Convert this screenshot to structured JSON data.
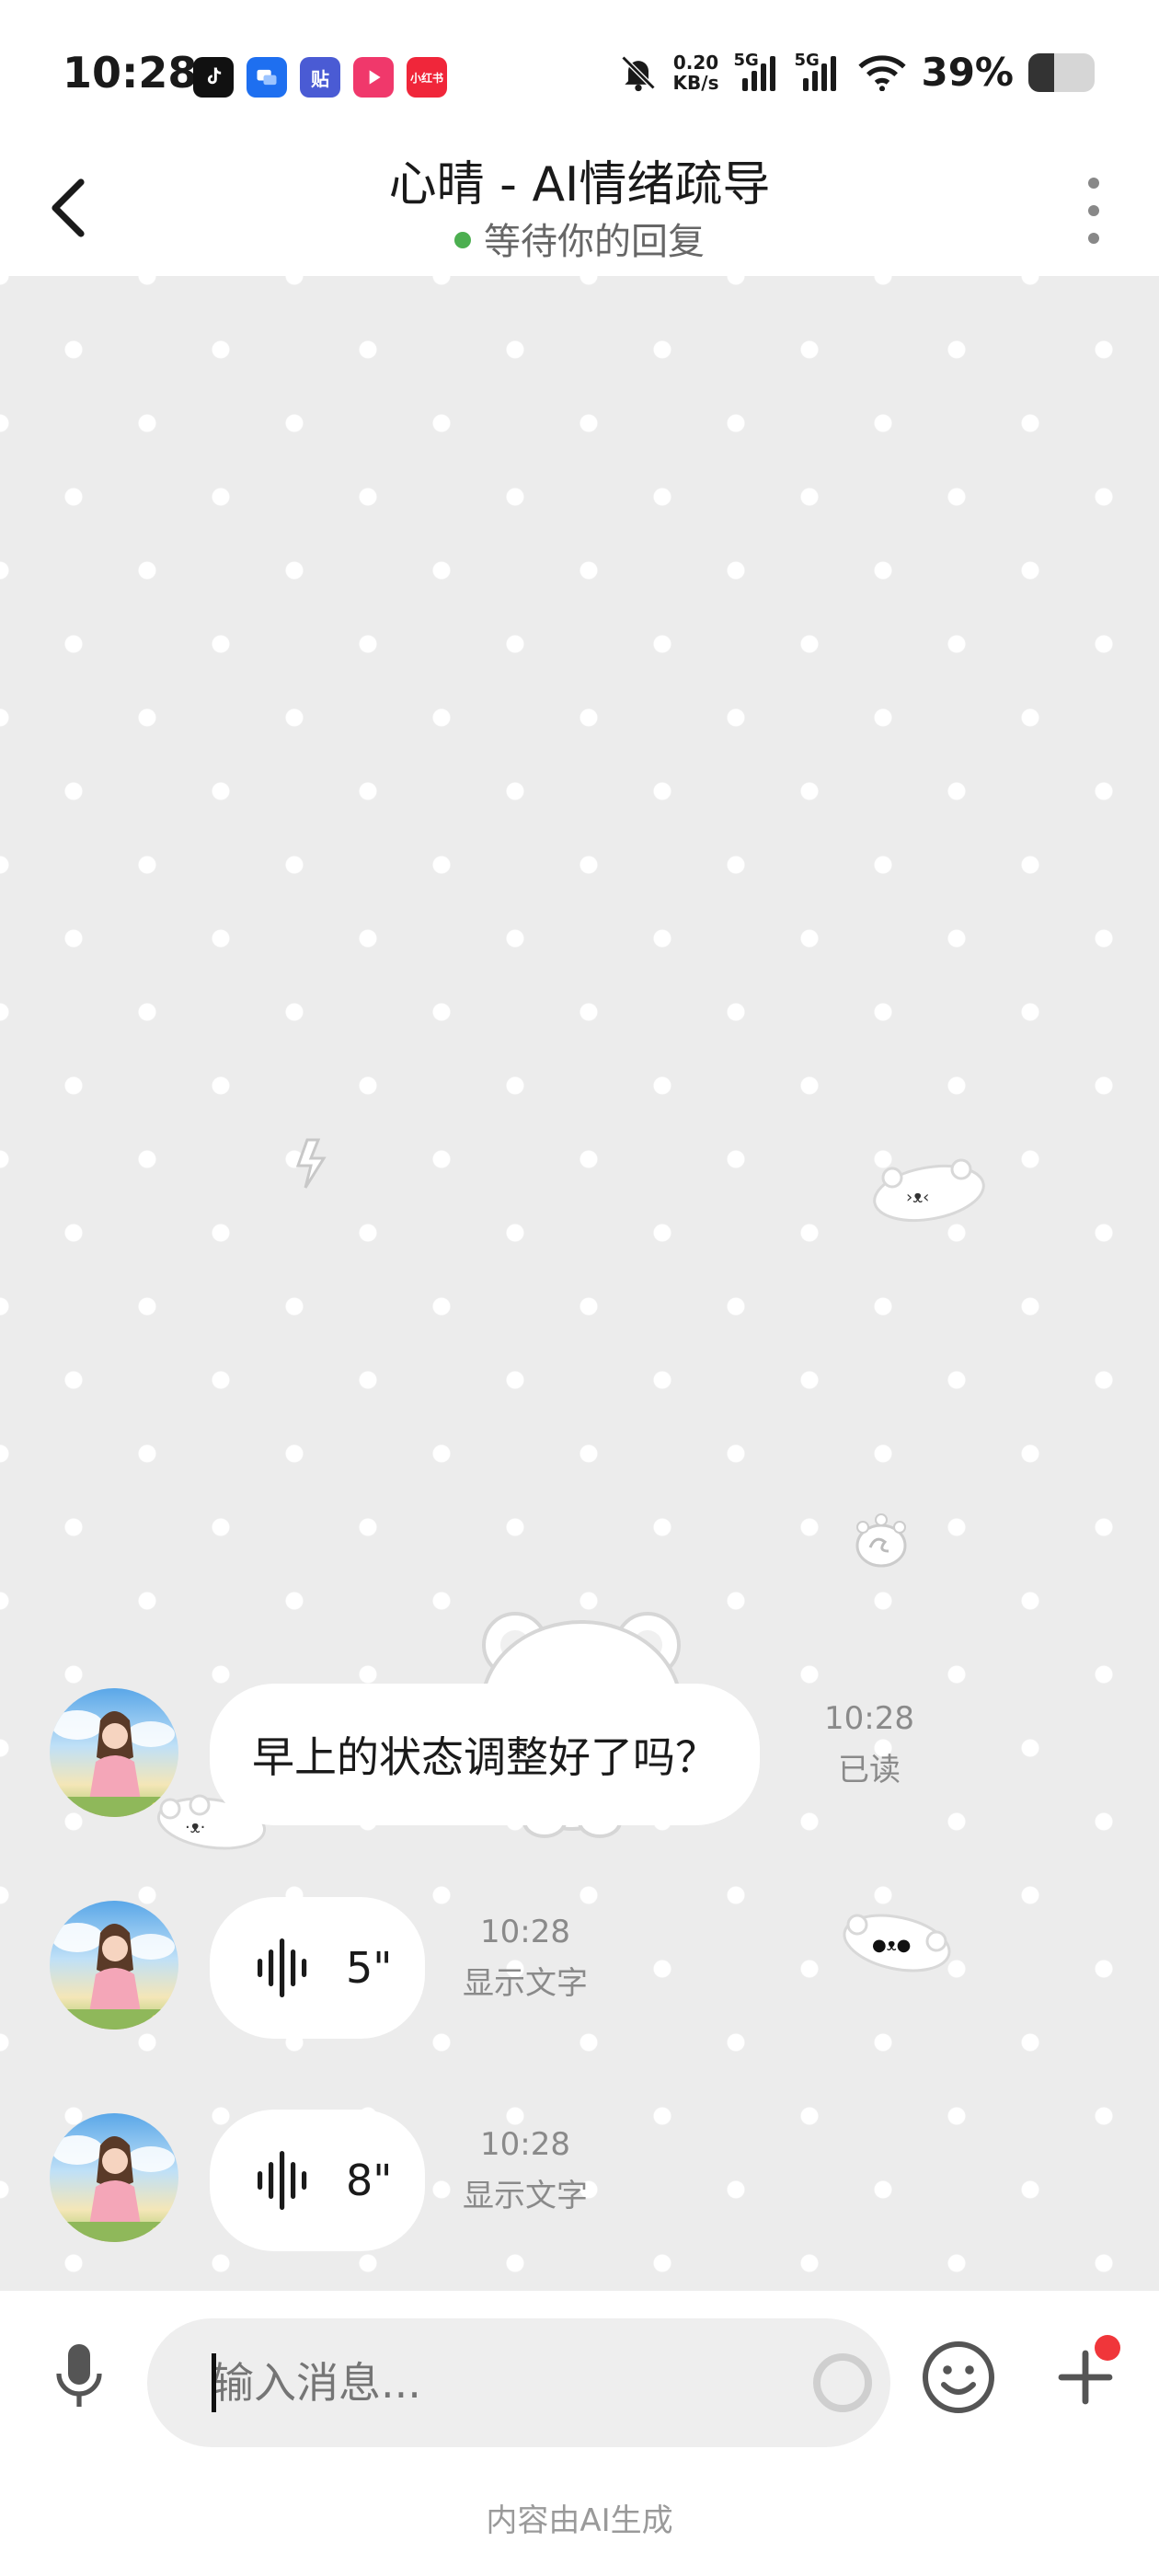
{
  "status_bar": {
    "time": "10:28",
    "net_speed_value": "0.20",
    "net_speed_unit": "KB/s",
    "signal1_label": "5G",
    "signal2_label": "5G",
    "battery_percent": "39%",
    "battery_level": 0.39,
    "app_icons": [
      "tiktok-icon",
      "chat-icon",
      "tieba-icon",
      "video-icon",
      "xiaohongshu-icon"
    ],
    "app_icon_texts": [
      "",
      "",
      "贴",
      "",
      "小红书"
    ],
    "app_icon_colors": [
      "#111111",
      "#1e6ff0",
      "#4a5bd4",
      "#f0386b",
      "#f0263a"
    ]
  },
  "header": {
    "title": "心晴 - AI情绪疏导",
    "status": "等待你的回复",
    "status_color": "#4caf50"
  },
  "messages": [
    {
      "type": "text",
      "text": "早上的状态调整好了吗？",
      "time": "10:28",
      "status": "已读"
    },
    {
      "type": "voice",
      "duration": "5\"",
      "time": "10:28",
      "action": "显示文字"
    },
    {
      "type": "voice",
      "duration": "8\"",
      "time": "10:28",
      "action": "显示文字"
    }
  ],
  "input_bar": {
    "placeholder": "输入消息..."
  },
  "footer_note": "内容由AI生成"
}
